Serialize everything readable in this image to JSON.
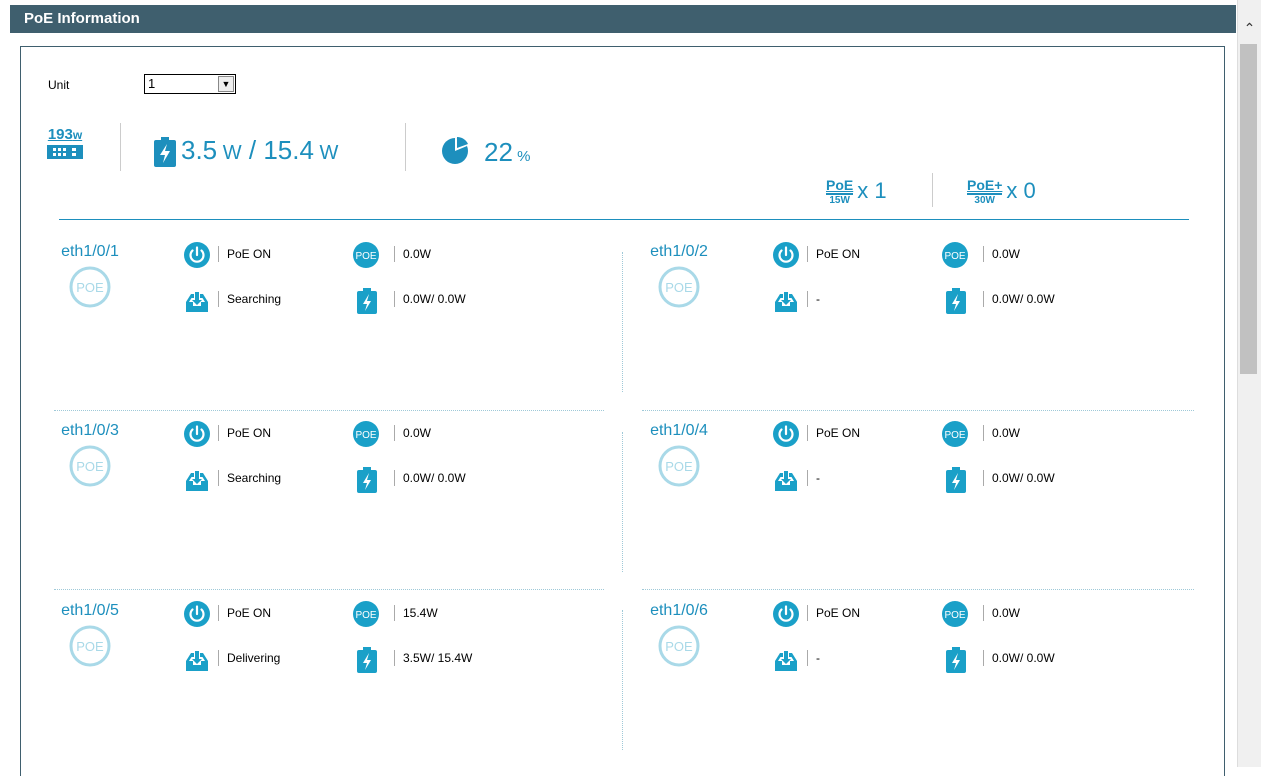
{
  "title": "PoE Information",
  "unit": {
    "label": "Unit",
    "value": "1"
  },
  "summary": {
    "total_power": "193",
    "total_power_unit": "w",
    "used": "3.5",
    "used_unit": "W",
    "separator": "/",
    "budget": "15.4",
    "budget_unit": "W",
    "percent": "22",
    "percent_unit": "%"
  },
  "poe_types": [
    {
      "name": "PoE",
      "rating": "15W",
      "count": "x 1"
    },
    {
      "name": "PoE+",
      "rating": "30W",
      "count": "x 0"
    }
  ],
  "ports": [
    {
      "name": "eth1/0/1",
      "state": "PoE ON",
      "status": "Searching",
      "class_power": "0.0W",
      "power": "0.0W/ 0.0W"
    },
    {
      "name": "eth1/0/2",
      "state": "PoE ON",
      "status": "-",
      "class_power": "0.0W",
      "power": "0.0W/ 0.0W"
    },
    {
      "name": "eth1/0/3",
      "state": "PoE ON",
      "status": "Searching",
      "class_power": "0.0W",
      "power": "0.0W/ 0.0W"
    },
    {
      "name": "eth1/0/4",
      "state": "PoE ON",
      "status": "-",
      "class_power": "0.0W",
      "power": "0.0W/ 0.0W"
    },
    {
      "name": "eth1/0/5",
      "state": "PoE ON",
      "status": "Delivering",
      "class_power": "15.4W",
      "power": "3.5W/ 15.4W"
    },
    {
      "name": "eth1/0/6",
      "state": "PoE ON",
      "status": "-",
      "class_power": "0.0W",
      "power": "0.0W/ 0.0W"
    }
  ],
  "badge_text": "POE",
  "icons": {
    "total": "switch-power-icon",
    "battery": "battery-icon",
    "pie": "pie-chart-icon",
    "state": "power-icon",
    "status": "download-icon",
    "class": "poe-circle-icon"
  },
  "colors": {
    "accent": "#1d8fbd",
    "titlebar": "#3f5f6e",
    "badge_light": "#a9d9e8"
  }
}
